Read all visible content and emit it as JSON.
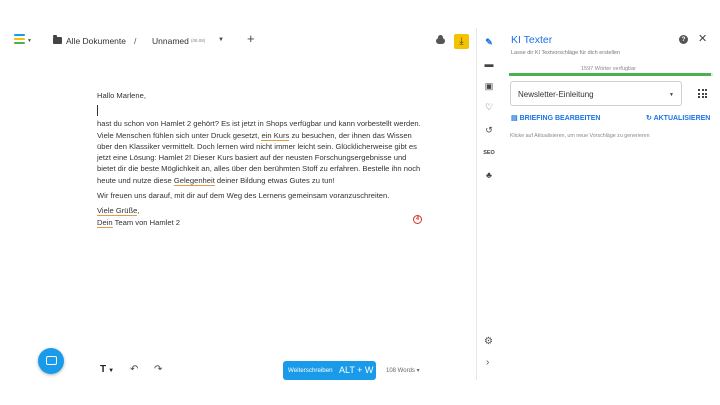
{
  "toolbar": {
    "breadcrumb_root": "Alle Dokumente",
    "separator": "/",
    "document_name": "Unnamed",
    "document_date": "(08.08)",
    "add_label": "+",
    "download_label": "⤓"
  },
  "editor": {
    "greeting": "Hallo Marlene,",
    "para1_a": "hast du schon von Hamlet 2 gehört? Es ist jetzt in Shops verfügbar und kann vorbestellt werden. Viele Menschen fühlen sich unter Druck gesetzt, ",
    "para1_u1": "ein Kurs",
    "para1_b": " zu besuchen, der ihnen das Wissen über den Klassiker vermittelt. Doch lernen wird nicht immer leicht sein. Glücklicherweise gibt es jetzt eine Lösung: Hamlet 2! Dieser Kurs basiert auf der neusten Forschungsergebnisse und bietet dir die beste Möglichkeit an, alles über den berühmten Stoff zu erfahren. Bestelle ihn noch heute und nutze diese ",
    "para1_u2": "Gelegenheit",
    "para1_c": " deiner Bildung etwas Gutes zu tun!",
    "para2": "Wir freuen uns darauf, mit dir auf dem Weg des Lernens gemeinsam voranzuschreiten.",
    "closing_u": "Viele Grüße",
    "closing_rest": ",",
    "sign_u": "Dein",
    "sign_rest": " Team von Hamlet 2",
    "error_count": "4"
  },
  "bottom": {
    "text_format": "T",
    "weiterschreiben": "Weiterschreiben",
    "shortcut": "ALT + W",
    "word_count": "108 Words"
  },
  "panel": {
    "title": "KI Texter",
    "help": "?",
    "close": "✕",
    "subtitle": "Lasse dir KI Textvorschläge für dich erstellen",
    "quota": "1597 Wörter verfügbar",
    "quota_fraction": 0.99,
    "select_value": "Newsletter-Einleitung",
    "briefing": "BRIEFING BEARBEITEN",
    "refresh": "AKTUALISIEREN",
    "hint": "Klicke auf Aktualisieren, um neue Vorschläge zu generieren"
  },
  "rail": {
    "seo": "SEO"
  },
  "icons": [
    "menu-icon",
    "folder-icon",
    "cloud-icon",
    "download-icon",
    "ai-icon",
    "comment-icon",
    "image-icon",
    "heart-icon",
    "history-icon",
    "seo-icon",
    "shapes-icon",
    "gear-icon",
    "chevron-right-icon",
    "chat-icon",
    "undo-icon",
    "redo-icon",
    "grid-icon",
    "edit-icon",
    "refresh-icon"
  ],
  "colors": {
    "accent": "#1a73e8",
    "button": "#1a9bea",
    "download": "#f3c200",
    "quota": "#4caf50",
    "error": "#d93025"
  }
}
